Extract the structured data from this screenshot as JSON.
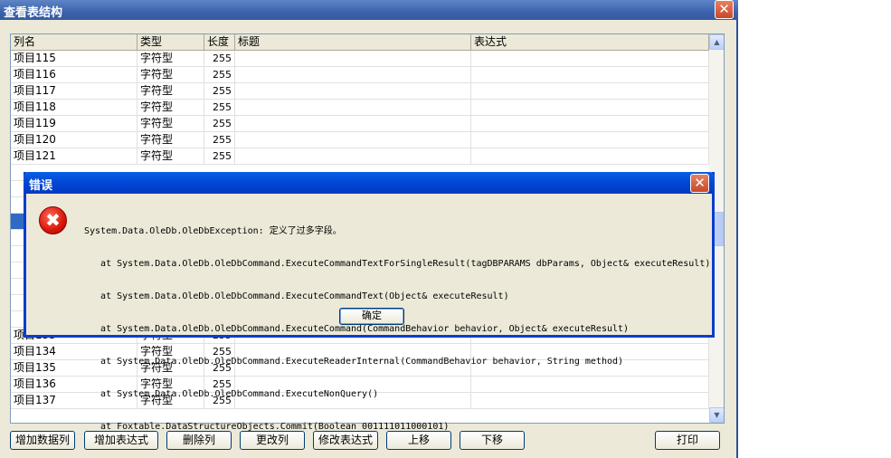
{
  "main_window": {
    "title": "查看表结构",
    "close_glyph": "✕"
  },
  "grid": {
    "columns": [
      "列名",
      "类型",
      "长度",
      "标题",
      "表达式"
    ],
    "top_rows": [
      {
        "name": "项目115",
        "type": "字符型",
        "length": "255"
      },
      {
        "name": "项目116",
        "type": "字符型",
        "length": "255"
      },
      {
        "name": "项目117",
        "type": "字符型",
        "length": "255"
      },
      {
        "name": "项目118",
        "type": "字符型",
        "length": "255"
      },
      {
        "name": "项目119",
        "type": "字符型",
        "length": "255"
      },
      {
        "name": "项目120",
        "type": "字符型",
        "length": "255"
      },
      {
        "name": "项目121",
        "type": "字符型",
        "length": "255"
      }
    ],
    "bottom_rows": [
      {
        "name": "项目133",
        "type": "字符型",
        "length": "255"
      },
      {
        "name": "项目134",
        "type": "字符型",
        "length": "255"
      },
      {
        "name": "项目135",
        "type": "字符型",
        "length": "255"
      },
      {
        "name": "项目136",
        "type": "字符型",
        "length": "255"
      },
      {
        "name": "项目137",
        "type": "字符型",
        "length": "255"
      }
    ],
    "scroll_up_glyph": "▲",
    "scroll_down_glyph": "▼"
  },
  "toolbar": {
    "add_field": "增加数据列",
    "add_expression": "增加表达式",
    "delete_column": "删除列",
    "change_column": "更改列",
    "edit_expression": "修改表达式",
    "move_up": "上移",
    "move_down": "下移",
    "print": "打印"
  },
  "error_dialog": {
    "title": "错误",
    "close_glyph": "✕",
    "icon": "error-icon",
    "icon_glyph": "✖",
    "message_lines": [
      "System.Data.OleDb.OleDbException: 定义了过多字段。",
      "   at System.Data.OleDb.OleDbCommand.ExecuteCommandTextForSingleResult(tagDBPARAMS dbParams, Object& executeResult)",
      "   at System.Data.OleDb.OleDbCommand.ExecuteCommandText(Object& executeResult)",
      "   at System.Data.OleDb.OleDbCommand.ExecuteCommand(CommandBehavior behavior, Object& executeResult)",
      "   at System.Data.OleDb.OleDbCommand.ExecuteReaderInternal(CommandBehavior behavior, String method)",
      "   at System.Data.OleDb.OleDbCommand.ExecuteNonQuery()",
      "   at Foxtable.DataStructureObjects.Commit(Boolean 001111011000101)"
    ],
    "ok_label": "确定"
  },
  "colors": {
    "selected_row": "#316ac5",
    "dialog_titlebar": "#0046d5",
    "window_titlebar": "#3c63ad"
  }
}
